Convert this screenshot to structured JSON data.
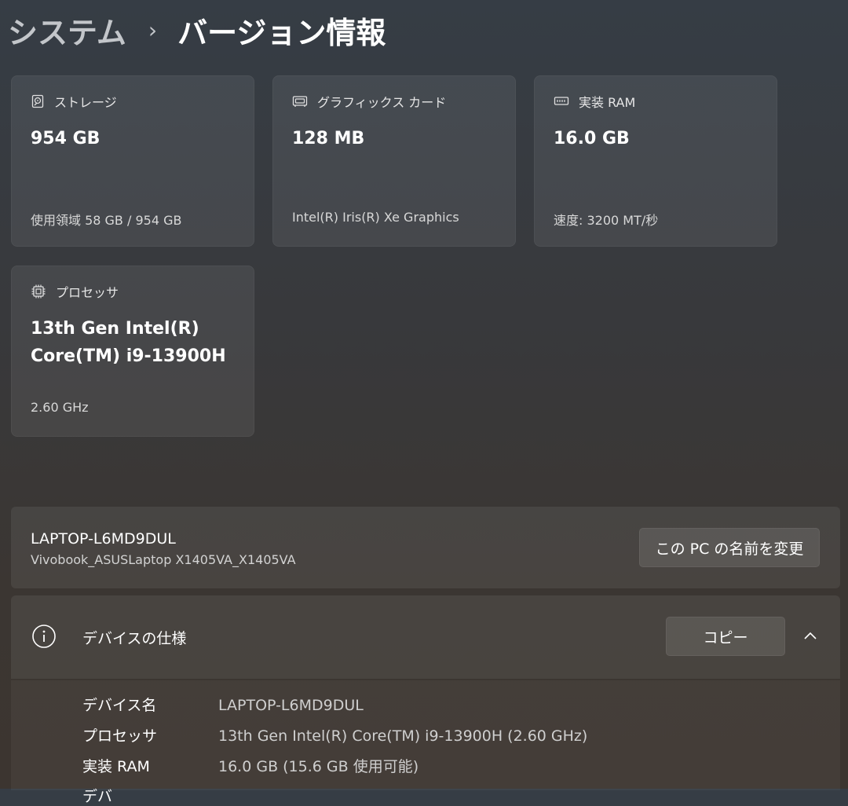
{
  "breadcrumb": {
    "parent": "システム",
    "separator": "›",
    "current": "バージョン情報"
  },
  "cards": {
    "storage": {
      "icon": "hard-drive-icon",
      "title": "ストレージ",
      "value": "954 GB",
      "sub": "使用領域 58 GB / 954 GB"
    },
    "gpu": {
      "icon": "graphics-card-icon",
      "title": "グラフィックス カード",
      "value": "128 MB",
      "sub": "Intel(R) Iris(R) Xe Graphics"
    },
    "ram": {
      "icon": "memory-icon",
      "title": "実装 RAM",
      "value": "16.0 GB",
      "sub": "速度: 3200 MT/秒"
    },
    "cpu": {
      "icon": "processor-icon",
      "title": "プロセッサ",
      "value_line1": "13th Gen Intel(R)",
      "value_line2": "Core(TM) i9-13900H",
      "sub": "2.60 GHz"
    }
  },
  "pc": {
    "name": "LAPTOP-L6MD9DUL",
    "model": "Vivobook_ASUSLaptop X1405VA_X1405VA",
    "rename_label": "この PC の名前を変更"
  },
  "device_specs": {
    "title": "デバイスの仕様",
    "copy_label": "コピー",
    "rows": [
      {
        "label": "デバイス名",
        "value": "LAPTOP-L6MD9DUL"
      },
      {
        "label": "プロセッサ",
        "value": "13th Gen Intel(R) Core(TM) i9-13900H (2.60 GHz)"
      },
      {
        "label": "実装 RAM",
        "value": "16.0 GB (15.6 GB 使用可能)"
      }
    ],
    "partial_label": "デバ"
  },
  "colors": {
    "background": "#38393c",
    "card": "#4a4c4f",
    "text": "#ffffff",
    "muted_text": "#cfcfcf"
  }
}
